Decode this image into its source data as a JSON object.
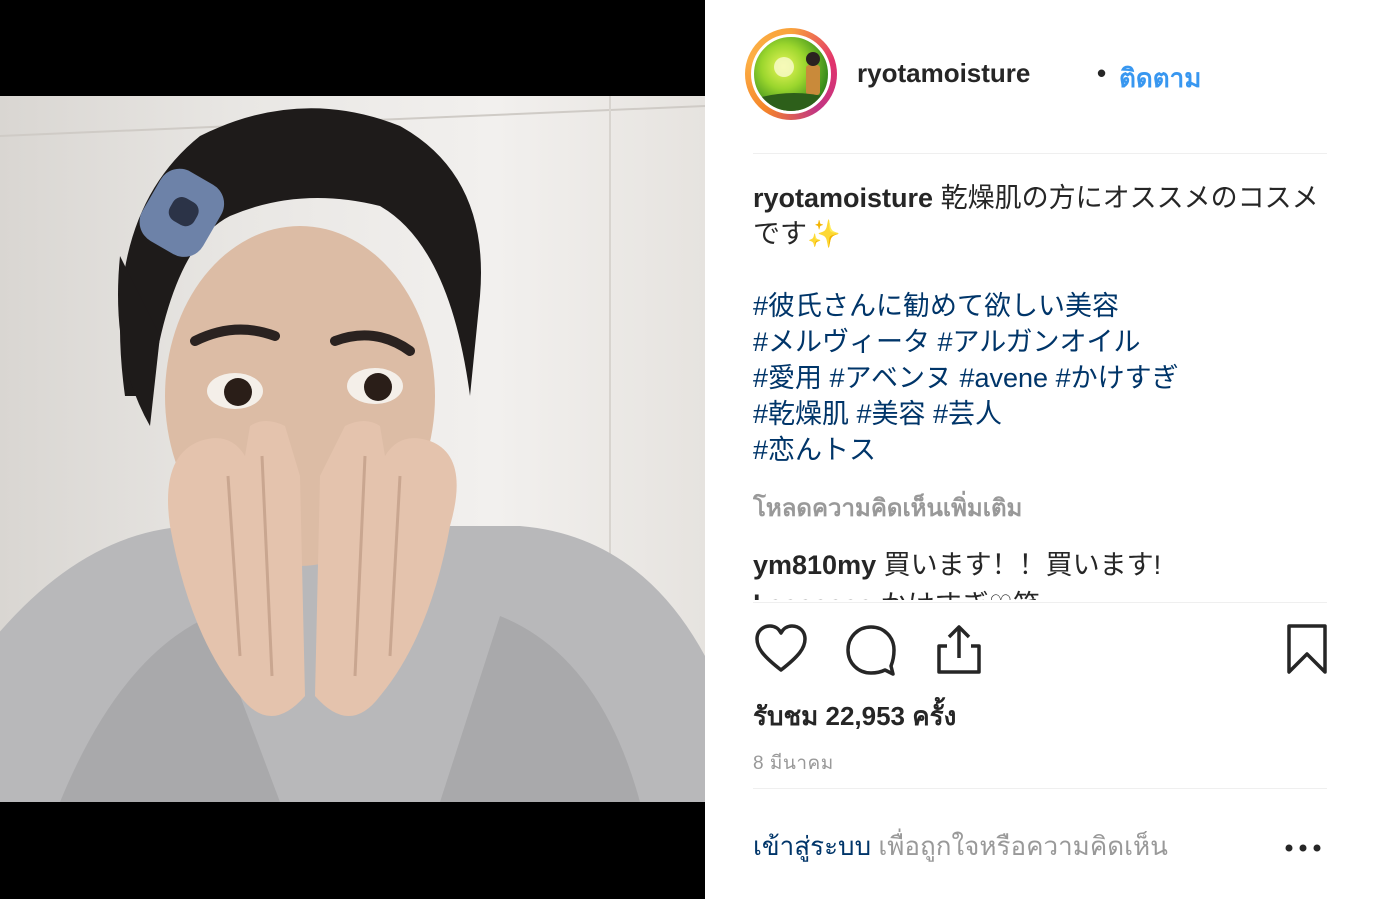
{
  "post": {
    "username": "ryotamoisture",
    "follow_label": "ติดตาม",
    "caption": {
      "username": "ryotamoisture",
      "text": "乾燥肌の方にオススメのコスメです✨",
      "hashtag_lines": [
        "#彼氏さんに勧めて欲しい美容",
        "#メルヴィータ #アルガンオイル",
        "#愛用 #アベンヌ #avene #かけすぎ",
        "#乾燥肌 #美容 #芸人",
        "#恋んトス"
      ]
    },
    "load_more_comments": "โหลดความคิดเห็นเพิ่มเติม",
    "comments": [
      {
        "username": "ym810my",
        "text": "買います！！買います!"
      },
      {
        "username": "kaaaaaaa",
        "text": "かけすぎ♡笑"
      }
    ],
    "views_text": "รับชม 22,953 ครั้ง",
    "date": "8 มีนาคม",
    "login_link": "เข้าสู่ระบบ",
    "login_rest": "เพื่อถูกใจหรือความคิดเห็น"
  },
  "icons": {
    "like": "heart-icon",
    "comment": "comment-icon",
    "share": "share-icon",
    "save": "bookmark-icon",
    "options": "more-options-icon"
  },
  "colors": {
    "link_blue": "#3897f0",
    "hashtag": "#003569",
    "muted": "#999999",
    "text": "#262626"
  }
}
